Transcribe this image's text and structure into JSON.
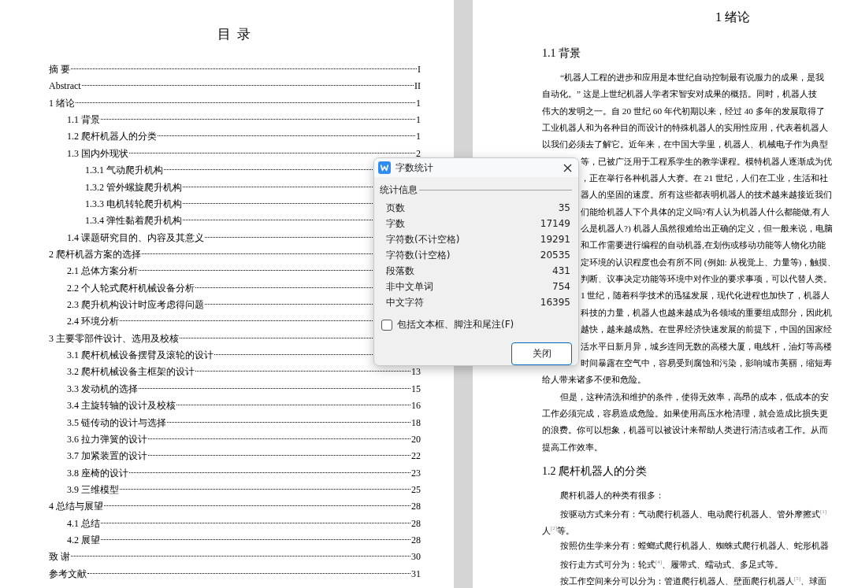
{
  "toc": {
    "title": "目 录",
    "entries": [
      {
        "label": "摘 要",
        "page": "I"
      },
      {
        "label": "Abstract",
        "page": "II"
      },
      {
        "label": "1 绪论",
        "page": "1",
        "children": [
          {
            "label": "1.1 背景",
            "page": "1"
          },
          {
            "label": "1.2 爬杆机器人的分类",
            "page": "1"
          },
          {
            "label": "1.3 国内外现状",
            "page": "2",
            "children": [
              {
                "label": "1.3.1 气动爬升机构"
              },
              {
                "label": "1.3.2 管外螺旋爬升机构"
              },
              {
                "label": "1.3.3 电机转轮爬升机构"
              },
              {
                "label": "1.3.4 弹性黏着爬升机构"
              }
            ]
          },
          {
            "label": "1.4 课题研究目的、内容及其意义"
          }
        ]
      },
      {
        "label": "2 爬杆机器方案的选择",
        "children": [
          {
            "label": "2.1 总体方案分析"
          },
          {
            "label": "2.2 个人轮式爬杆机械设备分析"
          },
          {
            "label": "2.3 爬升机构设计时应考虑得问题"
          },
          {
            "label": "2.4 环境分析"
          }
        ]
      },
      {
        "label": "3 主要零部件设计、选用及校核",
        "children": [
          {
            "label": "3.1 爬杆机械设备摆臂及滚轮的设计"
          },
          {
            "label": "3.2 爬杆机械设备主框架的设计",
            "page": "13"
          },
          {
            "label": "3.3 发动机的选择",
            "page": "15"
          },
          {
            "label": "3.4 主旋转轴的设计及校核",
            "page": "16"
          },
          {
            "label": "3.5 链传动的设计与选择",
            "page": "18"
          },
          {
            "label": "3.6 拉力弹簧的设计",
            "page": "20"
          },
          {
            "label": "3.7 加紧装置的设计",
            "page": "22"
          },
          {
            "label": "3.8 座椅的设计",
            "page": "23"
          },
          {
            "label": "3.9 三维模型",
            "page": "25"
          }
        ]
      },
      {
        "label": "4 总结与展望",
        "page": "28",
        "children": [
          {
            "label": "4.1 总结",
            "page": "28"
          },
          {
            "label": "4.2 展望",
            "page": "28"
          }
        ]
      },
      {
        "label": "致 谢",
        "page": "30"
      },
      {
        "label": "参考文献",
        "page": "31"
      }
    ]
  },
  "page": {
    "chapter": "1 绪论",
    "sections": [
      {
        "heading": "1.1 背景",
        "lines": [
          {
            "kind": "first",
            "text": "“机器人工程的进步和应用是本世纪自动控制最有说服力的成果，是我"
          },
          {
            "kind": "plain",
            "text": "自动化。” 这是上世纪机器人学者宋智安对成果的概括。同时，机器人技"
          },
          {
            "kind": "plain",
            "text": "伟大的发明之一。自 20 世纪 60 年代初期以来，经过 40 多年的发展取得了"
          },
          {
            "kind": "plain",
            "text": "工业机器人和为各种目的而设计的特殊机器人的实用性应用，代表着机器人"
          },
          {
            "kind": "plain",
            "text": "以我们必须去了解它。近年来，在中国大学里，机器人、机械电子作为典型"
          },
          {
            "kind": "covered",
            "text": "等，已被广泛用于工程系学生的教学课程。模特机器人逐渐成为优"
          },
          {
            "kind": "covered",
            "text": "，正在举行各种机器人大赛。在 21 世纪，人们在工业，生活和社"
          },
          {
            "kind": "covered",
            "text": "器人的坚固的速度。所有这些都表明机器人的技术越来越接近我们"
          },
          {
            "kind": "covered",
            "text": "们能给机器人下个具体的定义吗?有人认为机器人什么都能做,有人"
          },
          {
            "kind": "covered",
            "text": "么是机器人?) 机器人虽然很难给出正确的定义，但一般来说，电脑"
          },
          {
            "kind": "covered",
            "text": "和工作需要进行编程的自动机器,在划伤或移动功能等人物化功能"
          },
          {
            "kind": "covered",
            "text": "定环境的认识程度也会有所不同 (例如: 从视觉上、力量等)，触摸、"
          },
          {
            "kind": "covered",
            "text": "判断、议事决定功能等环境中对作业的要求事项，可以代替人类。"
          },
          {
            "kind": "covered",
            "text": "1 世纪，随着科学技术的迅猛发展，现代化进程也加快了，机器人"
          },
          {
            "kind": "covered",
            "text": "科技的力量，机器人也越来越成为各领域的重要组成部分，因此机"
          },
          {
            "kind": "covered",
            "text": "越快，越来越成熟。在世界经济快速发展的前提下，中国的国家经"
          },
          {
            "kind": "covered",
            "text": "活水平日新月异，城乡连同无数的高楼大厦，电线杆，油灯等高楼"
          },
          {
            "kind": "covered",
            "text": "时间暴露在空气中，容易受到腐蚀和污染，影响城市美丽，缩短寿"
          },
          {
            "kind": "plain",
            "text": "给人带来诸多不便和危险。"
          },
          {
            "kind": "first",
            "text": "但是，这种清洗和维护的条件，使得无效率，高昂的成本，低成本的安"
          },
          {
            "kind": "plain",
            "text": "工作必须完成，容易造成危险。如果使用高压水枪清理，就会造成比损失更"
          },
          {
            "kind": "plain",
            "text": "的浪费。你可以想象，机器可以被设计来帮助人类进行清洁或者工作。从而"
          },
          {
            "kind": "plain",
            "text": "提高工作效率。"
          }
        ]
      },
      {
        "heading": "1.2 爬杆机器人的分类",
        "lines": [
          {
            "kind": "first",
            "text": "爬杆机器人的种类有很多："
          },
          {
            "kind": "first",
            "text": "按驱动方式来分有：气动爬行机器人、电动爬行机器人、管外摩擦式$^{[1]}$"
          },
          {
            "kind": "plain",
            "text": "人$^{[2]}$等。"
          },
          {
            "kind": "first",
            "text": "按照仿生学来分有：螳螂式爬行机器人、蜘蛛式爬行机器人、蛇形机器"
          },
          {
            "kind": "first",
            "text": "按行走方式可分为：轮式$^{[4]}$、履带式、蠕动式、多足式等。"
          },
          {
            "kind": "first",
            "text": "按工作空间来分可以分为：管道爬行机器人、壁面爬行机器人$^{[5]}$、球面"
          }
        ]
      }
    ]
  },
  "dialog": {
    "title": "字数统计",
    "group": "统计信息",
    "stats": [
      {
        "label": "页数",
        "value": "35"
      },
      {
        "label": "字数",
        "value": "17149"
      },
      {
        "label": "字符数(不计空格)",
        "value": "19291"
      },
      {
        "label": "字符数(计空格)",
        "value": "20535"
      },
      {
        "label": "段落数",
        "value": "431"
      },
      {
        "label": "非中文单词",
        "value": "754"
      },
      {
        "label": "中文字符",
        "value": "16395"
      }
    ],
    "option": {
      "label": "包括文本框、脚注和尾注(F)",
      "checked": false
    },
    "button": "关闭"
  }
}
